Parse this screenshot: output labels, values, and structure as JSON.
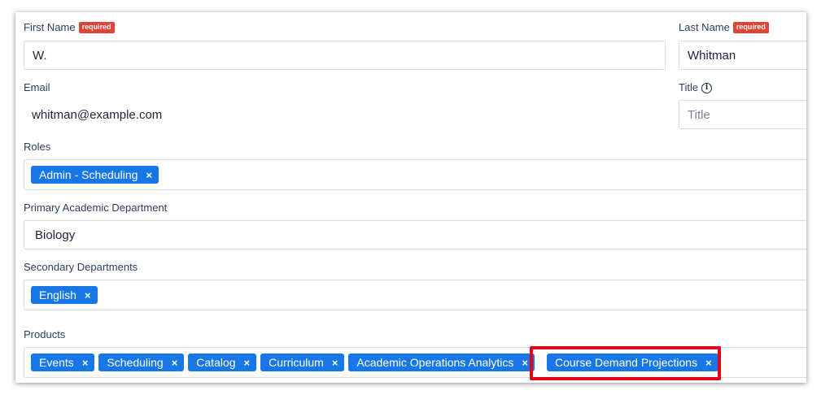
{
  "form": {
    "first_name": {
      "label": "First Name",
      "required_badge": "required",
      "value": "W."
    },
    "last_name": {
      "label": "Last Name",
      "required_badge": "required",
      "value": "Whitman"
    },
    "email": {
      "label": "Email",
      "value": "whitman@example.com"
    },
    "title": {
      "label": "Title",
      "placeholder": "Title",
      "info_icon": "info-circle-icon"
    },
    "roles": {
      "label": "Roles",
      "tags": [
        "Admin - Scheduling"
      ]
    },
    "primary_department": {
      "label": "Primary Academic Department",
      "value": "Biology"
    },
    "secondary_departments": {
      "label": "Secondary Departments",
      "tags": [
        "English"
      ]
    },
    "products": {
      "label": "Products",
      "tags": [
        "Events",
        "Scheduling",
        "Catalog",
        "Curriculum",
        "Academic Operations Analytics",
        "Course Demand Projections"
      ],
      "highlighted_tag": "Course Demand Projections"
    },
    "remove_glyph": "×"
  },
  "colors": {
    "tag": "#1877e6",
    "required_badge": "#e04436",
    "highlight_border": "#e3001b",
    "label_text": "#2c3e5d"
  }
}
